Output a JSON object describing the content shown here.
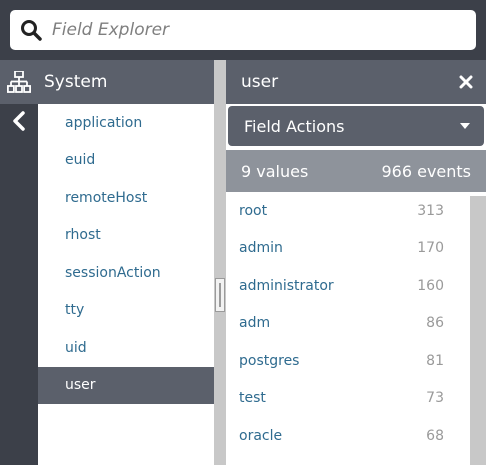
{
  "search": {
    "placeholder": "Field Explorer"
  },
  "left_panel": {
    "title": "System",
    "fields": [
      "application",
      "euid",
      "remoteHost",
      "rhost",
      "sessionAction",
      "tty",
      "uid",
      "user"
    ],
    "selected_index": 7
  },
  "right_panel": {
    "title": "user",
    "actions_label": "Field Actions",
    "values_count": "9 values",
    "events_count": "966 events",
    "values": [
      {
        "name": "root",
        "count": "313"
      },
      {
        "name": "admin",
        "count": "170"
      },
      {
        "name": "administrator",
        "count": "160"
      },
      {
        "name": "adm",
        "count": "86"
      },
      {
        "name": "postgres",
        "count": "81"
      },
      {
        "name": "test",
        "count": "73"
      },
      {
        "name": "oracle",
        "count": "68"
      }
    ]
  },
  "colors": {
    "background": "#3c4049",
    "header": "#5b606b",
    "summary": "#8e939b",
    "link": "#2f6b8f"
  },
  "icons": {
    "search": "search-icon",
    "tree": "sitemap-icon",
    "back": "chevron-left-icon",
    "close": "close-icon",
    "caret": "caret-down-icon"
  }
}
